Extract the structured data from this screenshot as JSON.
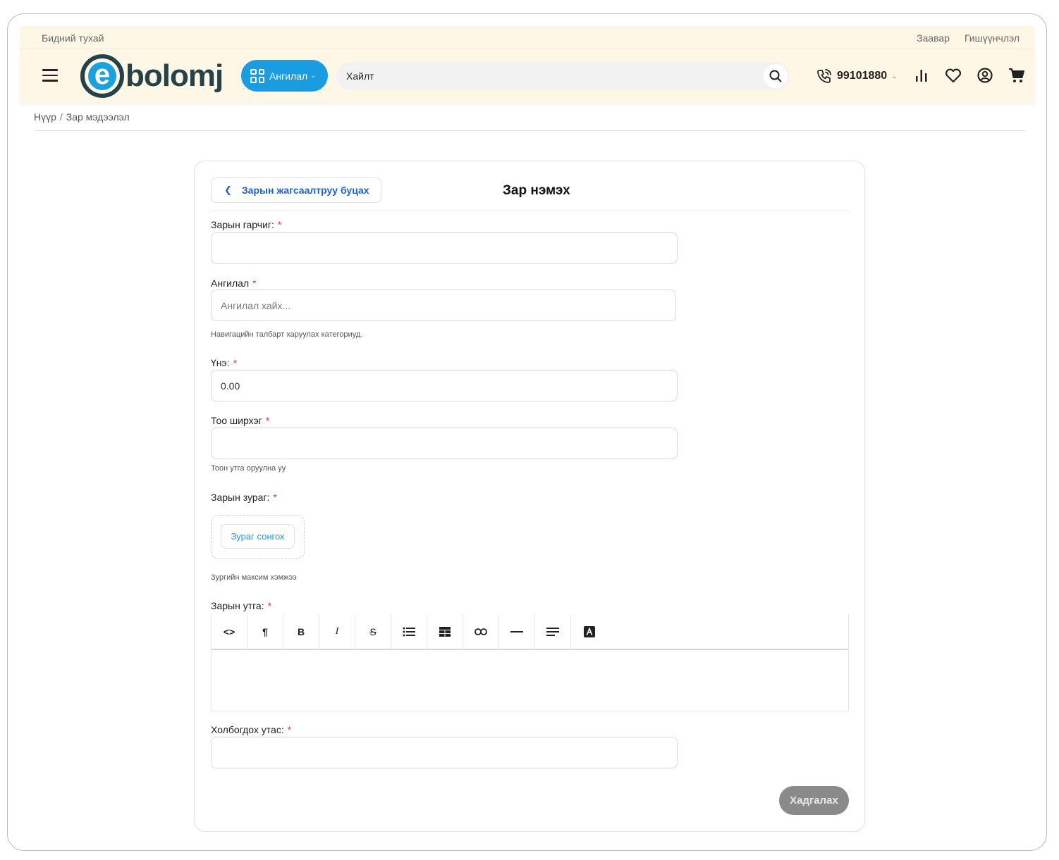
{
  "topbar": {
    "about": "Бидний тухай",
    "links": [
      "Заавар",
      "Гишүүнчлэл"
    ]
  },
  "header": {
    "logo_letter": "e",
    "logo_text": "bolomj",
    "category_button": "Ангилал",
    "search_placeholder": "Хайлт",
    "phone": "99101880"
  },
  "breadcrumb": {
    "home": "Нүүр",
    "separator": "/",
    "current": "Зар мэдээлэл"
  },
  "form": {
    "back_label": "Зарын жагсаалтруу буцах",
    "title": "Зар нэмэх",
    "required_mark": "*",
    "title_label": "Зарын гарчиг:",
    "category_label": "Ангилал",
    "category_placeholder": "Ангилал хайх...",
    "category_help": "Навигацийн талбарт харуулах категориуд.",
    "price_label": "Үнэ:",
    "price_value": "0.00",
    "qty_label": "Тоо ширхэг",
    "qty_help": "Тоон утга оруулна уу",
    "image_label": "Зарын зураг:",
    "image_button": "Зураг сонгох",
    "image_help": "Зургийн максим хэмжээ",
    "content_label": "Зарын утга:",
    "phone_label": "Холбогдох утас:",
    "save_label": "Хадгалах"
  },
  "toolbar": {
    "code": "<>",
    "paragraph": "¶",
    "bold": "B",
    "italic": "I",
    "strike": "S"
  },
  "colors": {
    "accent": "#1a9ce0",
    "header_bg": "#fef7e5",
    "link": "#1e62c9",
    "required": "#e53935"
  }
}
